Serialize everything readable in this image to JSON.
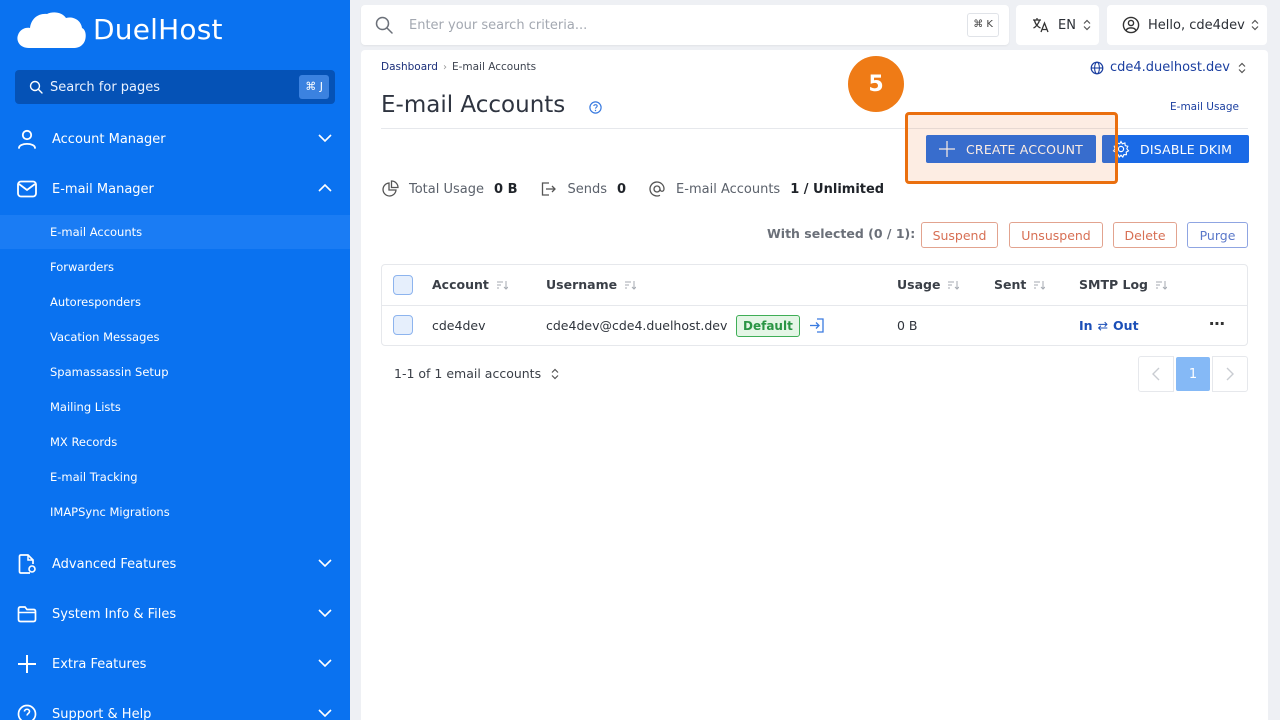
{
  "app": {
    "name": "DuelHost"
  },
  "sidebar": {
    "search_label": "Search for pages",
    "search_kbd": "⌘ J",
    "sections": [
      {
        "label": "Account Manager",
        "icon": "user-icon"
      },
      {
        "label": "E-mail Manager",
        "icon": "mail-icon"
      },
      {
        "label": "Advanced Features",
        "icon": "document-settings-icon"
      },
      {
        "label": "System Info & Files",
        "icon": "folder-icon"
      },
      {
        "label": "Extra Features",
        "icon": "plus-icon"
      },
      {
        "label": "Support & Help",
        "icon": "help-icon"
      }
    ],
    "email_items": [
      "E-mail Accounts",
      "Forwarders",
      "Autoresponders",
      "Vacation Messages",
      "Spamassassin Setup",
      "Mailing Lists",
      "MX Records",
      "E-mail Tracking",
      "IMAPSync Migrations"
    ]
  },
  "topbar": {
    "search_placeholder": "Enter your search criteria...",
    "search_kbd": "⌘ K",
    "language": "EN",
    "user_greeting": "Hello, cde4dev"
  },
  "breadcrumb": {
    "home": "Dashboard",
    "current": "E-mail Accounts"
  },
  "domain": "cde4.duelhost.dev",
  "page": {
    "title": "E-mail Accounts",
    "usage_link": "E-mail Usage",
    "create_button": "CREATE ACCOUNT",
    "dkim_button": "DISABLE DKIM",
    "step_number": "5"
  },
  "stats": {
    "total_usage_label": "Total Usage",
    "total_usage_value": "0 B",
    "sends_label": "Sends",
    "sends_value": "0",
    "accounts_label": "E-mail Accounts",
    "accounts_value": "1 / Unlimited"
  },
  "bulk": {
    "label": "With selected (0 / 1):",
    "suspend": "Suspend",
    "unsuspend": "Unsuspend",
    "delete": "Delete",
    "purge": "Purge"
  },
  "table": {
    "headers": [
      "Account",
      "Username",
      "Usage",
      "Sent",
      "SMTP Log"
    ],
    "rows": [
      {
        "account": "cde4dev",
        "username": "cde4dev@cde4.duelhost.dev",
        "badge": "Default",
        "usage": "0 B",
        "sent": "",
        "smtp_in": "In",
        "smtp_arrow": "⇄",
        "smtp_out": "Out"
      }
    ]
  },
  "pagination": {
    "info": "1-1 of 1 email accounts",
    "current_page": "1"
  },
  "colors": {
    "sidebar": "#0a72f0",
    "primary": "#1a6ae6",
    "highlight": "#ea6f0e",
    "badge_green": "#3fae57"
  }
}
